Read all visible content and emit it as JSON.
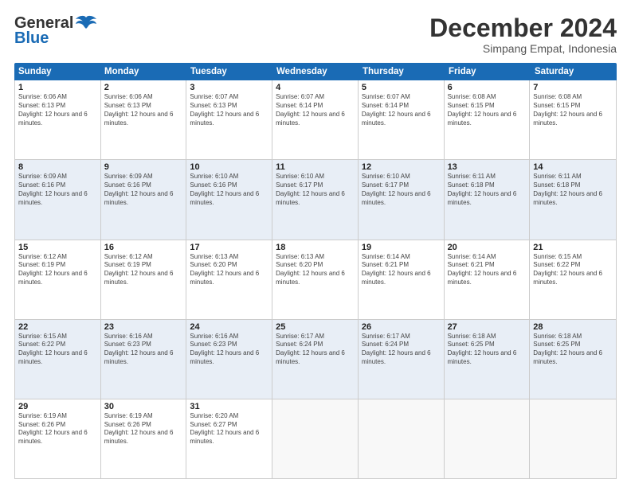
{
  "header": {
    "logo_general": "General",
    "logo_blue": "Blue",
    "month_title": "December 2024",
    "location": "Simpang Empat, Indonesia"
  },
  "weekdays": [
    "Sunday",
    "Monday",
    "Tuesday",
    "Wednesday",
    "Thursday",
    "Friday",
    "Saturday"
  ],
  "rows": [
    [
      {
        "day": "1",
        "sunrise": "6:06 AM",
        "sunset": "6:13 PM",
        "daylight": "12 hours and 6 minutes."
      },
      {
        "day": "2",
        "sunrise": "6:06 AM",
        "sunset": "6:13 PM",
        "daylight": "12 hours and 6 minutes."
      },
      {
        "day": "3",
        "sunrise": "6:07 AM",
        "sunset": "6:13 PM",
        "daylight": "12 hours and 6 minutes."
      },
      {
        "day": "4",
        "sunrise": "6:07 AM",
        "sunset": "6:14 PM",
        "daylight": "12 hours and 6 minutes."
      },
      {
        "day": "5",
        "sunrise": "6:07 AM",
        "sunset": "6:14 PM",
        "daylight": "12 hours and 6 minutes."
      },
      {
        "day": "6",
        "sunrise": "6:08 AM",
        "sunset": "6:15 PM",
        "daylight": "12 hours and 6 minutes."
      },
      {
        "day": "7",
        "sunrise": "6:08 AM",
        "sunset": "6:15 PM",
        "daylight": "12 hours and 6 minutes."
      }
    ],
    [
      {
        "day": "8",
        "sunrise": "6:09 AM",
        "sunset": "6:16 PM",
        "daylight": "12 hours and 6 minutes."
      },
      {
        "day": "9",
        "sunrise": "6:09 AM",
        "sunset": "6:16 PM",
        "daylight": "12 hours and 6 minutes."
      },
      {
        "day": "10",
        "sunrise": "6:10 AM",
        "sunset": "6:16 PM",
        "daylight": "12 hours and 6 minutes."
      },
      {
        "day": "11",
        "sunrise": "6:10 AM",
        "sunset": "6:17 PM",
        "daylight": "12 hours and 6 minutes."
      },
      {
        "day": "12",
        "sunrise": "6:10 AM",
        "sunset": "6:17 PM",
        "daylight": "12 hours and 6 minutes."
      },
      {
        "day": "13",
        "sunrise": "6:11 AM",
        "sunset": "6:18 PM",
        "daylight": "12 hours and 6 minutes."
      },
      {
        "day": "14",
        "sunrise": "6:11 AM",
        "sunset": "6:18 PM",
        "daylight": "12 hours and 6 minutes."
      }
    ],
    [
      {
        "day": "15",
        "sunrise": "6:12 AM",
        "sunset": "6:19 PM",
        "daylight": "12 hours and 6 minutes."
      },
      {
        "day": "16",
        "sunrise": "6:12 AM",
        "sunset": "6:19 PM",
        "daylight": "12 hours and 6 minutes."
      },
      {
        "day": "17",
        "sunrise": "6:13 AM",
        "sunset": "6:20 PM",
        "daylight": "12 hours and 6 minutes."
      },
      {
        "day": "18",
        "sunrise": "6:13 AM",
        "sunset": "6:20 PM",
        "daylight": "12 hours and 6 minutes."
      },
      {
        "day": "19",
        "sunrise": "6:14 AM",
        "sunset": "6:21 PM",
        "daylight": "12 hours and 6 minutes."
      },
      {
        "day": "20",
        "sunrise": "6:14 AM",
        "sunset": "6:21 PM",
        "daylight": "12 hours and 6 minutes."
      },
      {
        "day": "21",
        "sunrise": "6:15 AM",
        "sunset": "6:22 PM",
        "daylight": "12 hours and 6 minutes."
      }
    ],
    [
      {
        "day": "22",
        "sunrise": "6:15 AM",
        "sunset": "6:22 PM",
        "daylight": "12 hours and 6 minutes."
      },
      {
        "day": "23",
        "sunrise": "6:16 AM",
        "sunset": "6:23 PM",
        "daylight": "12 hours and 6 minutes."
      },
      {
        "day": "24",
        "sunrise": "6:16 AM",
        "sunset": "6:23 PM",
        "daylight": "12 hours and 6 minutes."
      },
      {
        "day": "25",
        "sunrise": "6:17 AM",
        "sunset": "6:24 PM",
        "daylight": "12 hours and 6 minutes."
      },
      {
        "day": "26",
        "sunrise": "6:17 AM",
        "sunset": "6:24 PM",
        "daylight": "12 hours and 6 minutes."
      },
      {
        "day": "27",
        "sunrise": "6:18 AM",
        "sunset": "6:25 PM",
        "daylight": "12 hours and 6 minutes."
      },
      {
        "day": "28",
        "sunrise": "6:18 AM",
        "sunset": "6:25 PM",
        "daylight": "12 hours and 6 minutes."
      }
    ],
    [
      {
        "day": "29",
        "sunrise": "6:19 AM",
        "sunset": "6:26 PM",
        "daylight": "12 hours and 6 minutes."
      },
      {
        "day": "30",
        "sunrise": "6:19 AM",
        "sunset": "6:26 PM",
        "daylight": "12 hours and 6 minutes."
      },
      {
        "day": "31",
        "sunrise": "6:20 AM",
        "sunset": "6:27 PM",
        "daylight": "12 hours and 6 minutes."
      },
      null,
      null,
      null,
      null
    ]
  ]
}
